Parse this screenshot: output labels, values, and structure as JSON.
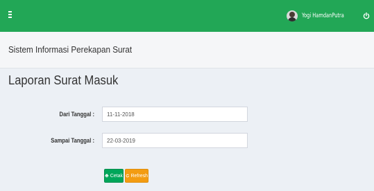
{
  "header": {
    "user_name": "Yogi HamdanPutra",
    "icons": [
      "menu-icon",
      "user-avatar",
      "power-icon"
    ],
    "bar_color": "#22a756"
  },
  "app": {
    "title": "Sistem Informasi Perekapan Surat"
  },
  "page": {
    "title": "Laporan Surat Masuk"
  },
  "form": {
    "from_label": "Dari Tanggal :",
    "from_value": "11-11-2018",
    "to_label": "Sampai Tanggal :",
    "to_value": "22-03-2019"
  },
  "buttons": {
    "print_label": "Cetak",
    "refresh_label": "Refresh",
    "print_color": "#00a65a",
    "refresh_color": "#f39c12"
  }
}
